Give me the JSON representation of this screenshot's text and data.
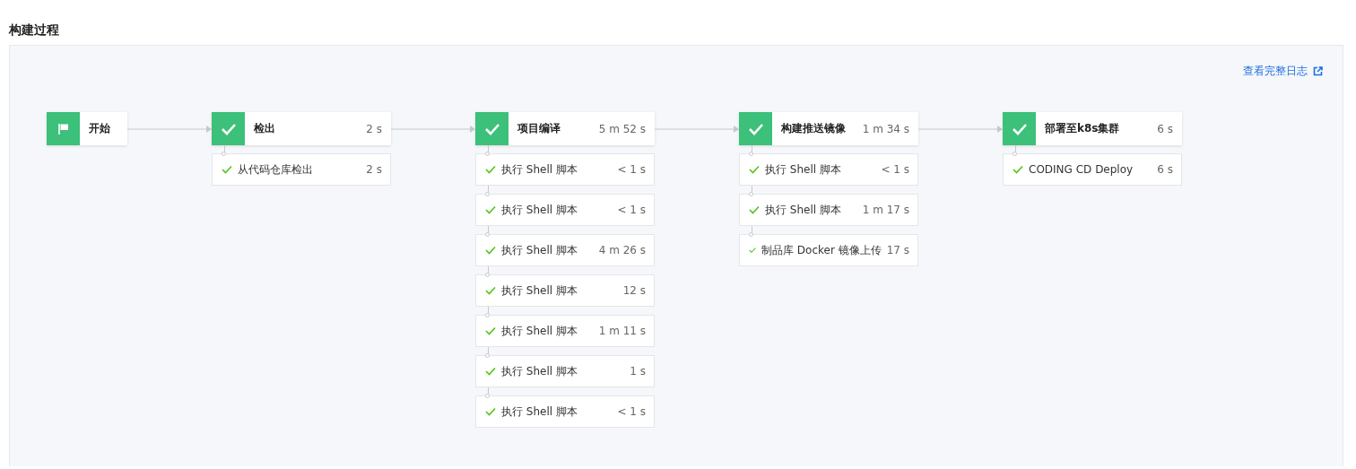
{
  "title": "构建过程",
  "log_link": "查看完整日志",
  "stages": [
    {
      "kind": "start",
      "name": "开始",
      "passed": true
    },
    {
      "kind": "stage",
      "name": "检出",
      "duration": "2 s",
      "passed": true,
      "steps": [
        {
          "name": "从代码仓库检出",
          "duration": "2 s",
          "passed": true
        }
      ]
    },
    {
      "kind": "stage",
      "name": "项目编译",
      "duration": "5 m 52 s",
      "passed": true,
      "steps": [
        {
          "name": "执行 Shell 脚本",
          "duration": "< 1 s",
          "passed": true
        },
        {
          "name": "执行 Shell 脚本",
          "duration": "< 1 s",
          "passed": true
        },
        {
          "name": "执行 Shell 脚本",
          "duration": "4 m 26 s",
          "passed": true
        },
        {
          "name": "执行 Shell 脚本",
          "duration": "12 s",
          "passed": true
        },
        {
          "name": "执行 Shell 脚本",
          "duration": "1 m 11 s",
          "passed": true
        },
        {
          "name": "执行 Shell 脚本",
          "duration": "1 s",
          "passed": true
        },
        {
          "name": "执行 Shell 脚本",
          "duration": "< 1 s",
          "passed": true
        }
      ]
    },
    {
      "kind": "stage",
      "name": "构建推送镜像",
      "duration": "1 m 34 s",
      "passed": true,
      "steps": [
        {
          "name": "执行 Shell 脚本",
          "duration": "< 1 s",
          "passed": true
        },
        {
          "name": "执行 Shell 脚本",
          "duration": "1 m 17 s",
          "passed": true
        },
        {
          "name": "制品库 Docker 镜像上传",
          "duration": "17 s",
          "passed": true
        }
      ]
    },
    {
      "kind": "stage",
      "name": "部署至k8s集群",
      "duration": "6 s",
      "passed": true,
      "steps": [
        {
          "name": "CODING CD Deploy",
          "duration": "6 s",
          "passed": true
        }
      ]
    }
  ]
}
